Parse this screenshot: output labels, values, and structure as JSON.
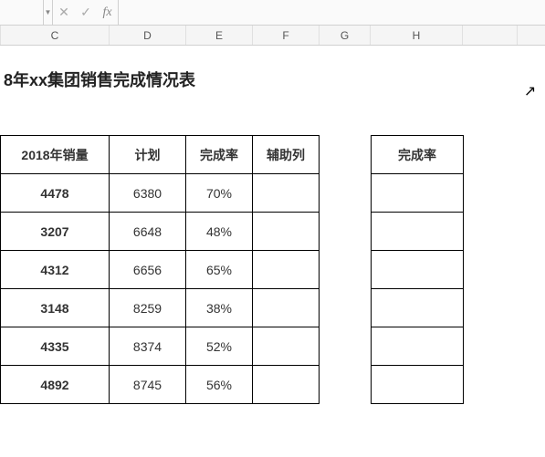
{
  "formula_bar": {
    "name_box": "",
    "cancel": "✕",
    "confirm": "✓",
    "fx": "fx",
    "input_value": ""
  },
  "columns": {
    "c": "C",
    "d": "D",
    "e": "E",
    "f": "F",
    "g": "G",
    "h": "H",
    "i": ""
  },
  "title": "8年xx集团销售完成情况表",
  "headers": {
    "sales": "2018年销量",
    "plan": "计划",
    "rate": "完成率",
    "aux": "辅助列",
    "side_rate": "完成率"
  },
  "rows": [
    {
      "sales": "4478",
      "plan": "6380",
      "rate": "70%",
      "aux": ""
    },
    {
      "sales": "3207",
      "plan": "6648",
      "rate": "48%",
      "aux": ""
    },
    {
      "sales": "4312",
      "plan": "6656",
      "rate": "65%",
      "aux": ""
    },
    {
      "sales": "3148",
      "plan": "8259",
      "rate": "38%",
      "aux": ""
    },
    {
      "sales": "4335",
      "plan": "8374",
      "rate": "52%",
      "aux": ""
    },
    {
      "sales": "4892",
      "plan": "8745",
      "rate": "56%",
      "aux": ""
    }
  ],
  "side_rows": [
    "",
    "",
    "",
    "",
    "",
    ""
  ]
}
